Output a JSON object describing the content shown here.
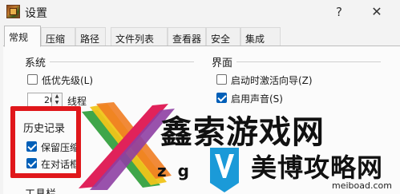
{
  "window": {
    "title": "设置",
    "help_glyph": "?",
    "close_glyph": "✕",
    "icon": "app-archive-icon"
  },
  "tabs": [
    {
      "label": "常规",
      "active": true
    },
    {
      "label": "压缩",
      "active": false
    },
    {
      "label": "路径",
      "active": false
    },
    {
      "label": "文件列表",
      "active": false
    },
    {
      "label": "查看器",
      "active": false
    },
    {
      "label": "安全",
      "active": false
    },
    {
      "label": "集成",
      "active": false
    }
  ],
  "system_group": {
    "title": "系统",
    "low_priority": {
      "label": "低优先级(L)",
      "checked": false
    },
    "threads_value": "20",
    "threads_label": "线程",
    "threads_partial": "线程"
  },
  "ui_group": {
    "title": "界面",
    "wizard_on_start": {
      "label": "启动时激活向导(Z)",
      "checked": false
    },
    "use_sound": {
      "label": "启用声音(S)",
      "checked": true
    }
  },
  "history_group": {
    "title": "历史记录",
    "keep_history": {
      "label": "保留压缩",
      "checked": true
    },
    "in_dialog": {
      "label": "在对话框",
      "checked": true
    }
  },
  "toolbar_group": {
    "title": "工具栏"
  },
  "watermark": {
    "brand_cn": "鑫索游戏网",
    "brand_latin": "zg",
    "brand_cn2": "美博攻略网",
    "url": "meiboad.com"
  },
  "colors": {
    "accent": "#005fb8",
    "highlight": "#e0171b",
    "window_bg": "#f3f3f3"
  }
}
